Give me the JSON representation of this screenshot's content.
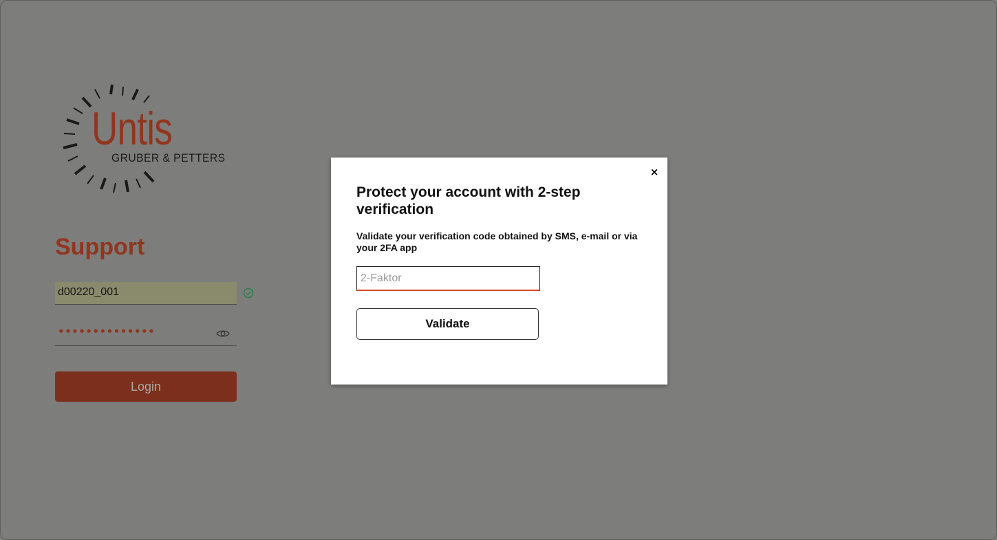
{
  "logo": {
    "wordmark": "Untis",
    "subtitle": "GRUBER & PETTERS"
  },
  "login": {
    "title": "Support",
    "username_value": "d00220_001",
    "password_mask": "••••••••••••••",
    "login_label": "Login",
    "username_valid_icon": "check-circle-icon",
    "show_password_icon": "eye-icon"
  },
  "modal": {
    "close_label": "×",
    "title": "Protect your account with 2-step verification",
    "description": "Validate your verification code obtained by SMS, e-mail or via your 2FA app",
    "code_placeholder": "2-Faktor",
    "code_value": "",
    "validate_label": "Validate"
  },
  "colors": {
    "overlay_background": "#7d7e7c",
    "brand_red": "#92351f",
    "login_button": "#7c2f1c",
    "valid_green": "#2e7d4f",
    "input_focus_underline": "#d9461f"
  }
}
